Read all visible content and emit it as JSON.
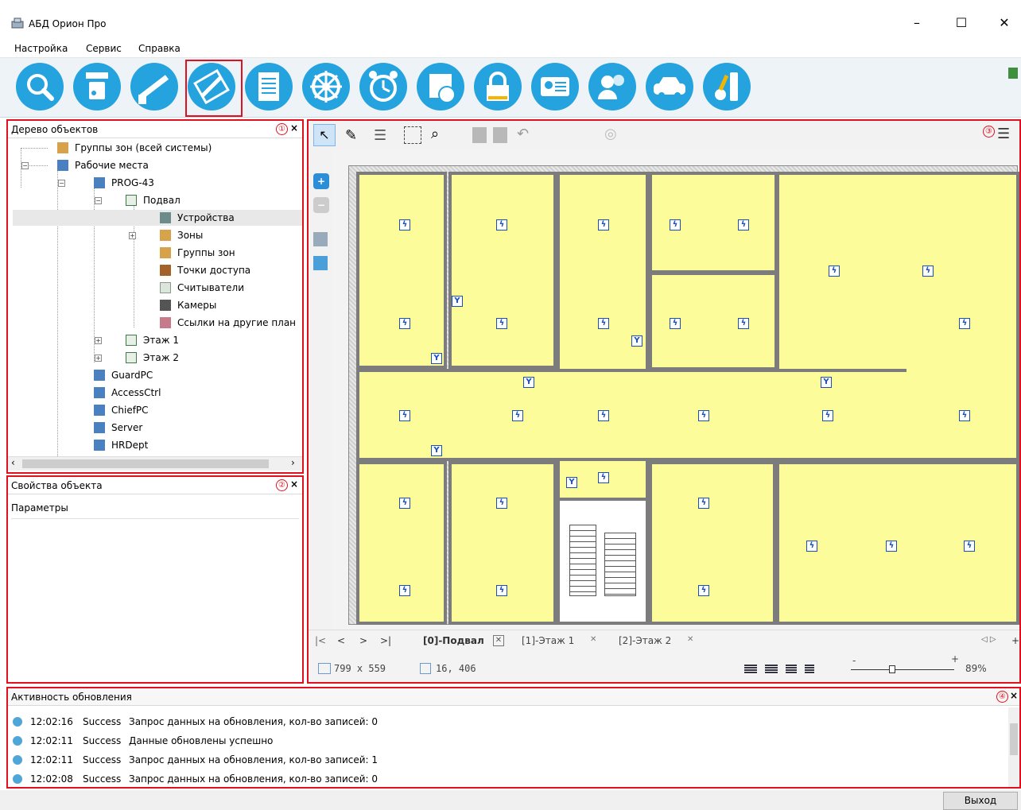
{
  "window": {
    "title": "АБД Орион Про",
    "minimize": "–",
    "maximize": "☐",
    "close": "✕"
  },
  "menu": [
    "Настройка",
    "Сервис",
    "Справка"
  ],
  "toolbar": {
    "buttons": [
      "search-icon",
      "devices-icon",
      "barrier-icon",
      "plan-editor-icon",
      "list-icon",
      "wheel-icon",
      "alarm-clock-icon",
      "schedule-icon",
      "lock-icon",
      "id-card-icon",
      "users-icon",
      "car-icon",
      "key-icon"
    ],
    "selected_index": 3
  },
  "tree_panel": {
    "title": "Дерево объектов",
    "badge": "①",
    "close": "×",
    "items": [
      "Группы зон (всей системы)",
      "Рабочие места",
      "PROG-43",
      "Подвал",
      "Устройства",
      "Зоны",
      "Группы зон",
      "Точки доступа",
      "Считыватели",
      "Камеры",
      "Ссылки на другие план",
      "Этаж 1",
      "Этаж 2",
      "GuardPC",
      "AccessCtrl",
      "ChiefPC",
      "Server",
      "HRDept"
    ],
    "selected": "Устройства"
  },
  "props_panel": {
    "title": "Свойства объекта",
    "badge": "②",
    "close": "×",
    "section": "Параметры"
  },
  "plan_panel": {
    "badge": "③",
    "tabs": [
      "[0]-Подвал",
      "[1]-Этаж 1",
      "[2]-Этаж 2"
    ],
    "active_tab": "[0]-Подвал",
    "tab_close": "✕",
    "nav": [
      "|<",
      "<",
      ">",
      ">|"
    ],
    "size": "799 x 559",
    "coords": "16, 406",
    "zoom": "89%",
    "zoom_fraction": 0.4,
    "zoom_minus": "-",
    "zoom_plus": "+",
    "scroll_arrows": "◁ ▷",
    "add_tab": "+"
  },
  "log_panel": {
    "title": "Активность обновления",
    "badge": "④",
    "close": "×",
    "rows": [
      {
        "time": "12:02:16",
        "status": "Success",
        "msg": "Запрос данных на обновления, кол-во записей: 0"
      },
      {
        "time": "12:02:11",
        "status": "Success",
        "msg": "Данные обновлены успешно"
      },
      {
        "time": "12:02:11",
        "status": "Success",
        "msg": "Запрос данных на обновления, кол-во записей: 1"
      },
      {
        "time": "12:02:08",
        "status": "Success",
        "msg": "Запрос данных на обновления, кол-во записей: 0"
      }
    ]
  },
  "footer": {
    "exit_label": "Выход"
  },
  "colors": {
    "accent": "#24a3df",
    "highlight": "#e0101f",
    "room": "#fdfc9a",
    "device": "#1b4fb5"
  }
}
